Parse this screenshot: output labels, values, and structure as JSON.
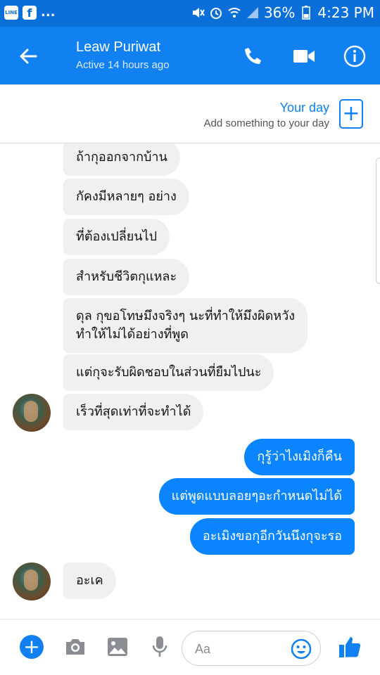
{
  "status_bar": {
    "app_icons": [
      "LINE",
      "f"
    ],
    "overflow": "...",
    "battery": "36%",
    "time": "4:23 PM"
  },
  "header": {
    "contact_name": "Leaw Puriwat",
    "contact_status": "Active 14 hours ago",
    "icons": [
      "back-arrow-icon",
      "phone-icon",
      "video-camera-icon",
      "info-icon"
    ]
  },
  "your_day": {
    "title": "Your day",
    "subtitle": "Add something to your day",
    "add_symbol": "+"
  },
  "messages": [
    {
      "sender": "contact",
      "text": "ถ้ากุออกจากบ้าน"
    },
    {
      "sender": "contact",
      "text": "กัคงมีหลายๆ อย่าง"
    },
    {
      "sender": "contact",
      "text": "ที่ต้องเปลี่ยนไป"
    },
    {
      "sender": "contact",
      "text": "สำหรับชีวิตกุแหละ"
    },
    {
      "sender": "contact",
      "text": "ดุล กุขอโทษมึงจริงๆ นะที่ทำให้มึงผิดหวัง\nทำให้ไม่ได้อย่างที่พูด"
    },
    {
      "sender": "contact",
      "text": "แต่กุจะรับผิดชอบในส่วนที่ยืมไปนะ"
    },
    {
      "sender": "contact",
      "text": "เร็วที่สุดเท่าที่จะทำได้"
    },
    {
      "sender": "me",
      "text": "กุรู้ว่าไงเมิงก็คืน"
    },
    {
      "sender": "me",
      "text": "แต่พูดแบบลอยๆอะกำหนดไม่ได้"
    },
    {
      "sender": "me",
      "text": "อะเมิงขอกุอีกวันนึงกุจะรอ"
    },
    {
      "sender": "contact",
      "text": "อะเค"
    }
  ],
  "composer": {
    "placeholder": "Aa",
    "icons": [
      "plus-icon",
      "camera-icon",
      "image-icon",
      "microphone-icon",
      "emoji-icon",
      "thumbs-up-icon"
    ]
  },
  "colors": {
    "header_blue": "#1181f2",
    "sent_bubble": "#0a84ff",
    "received_bubble": "#f1f0f0"
  }
}
